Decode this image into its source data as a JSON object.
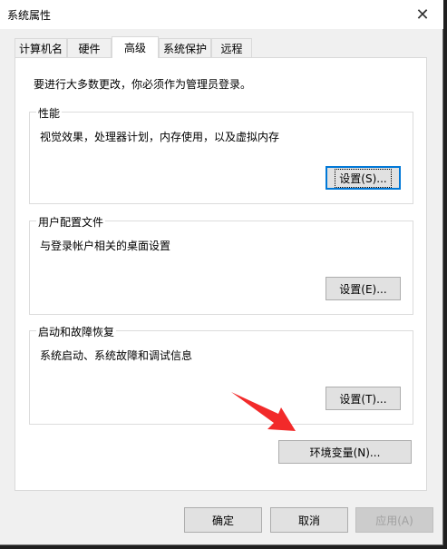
{
  "window": {
    "title": "系统属性",
    "close_glyph": "✕"
  },
  "tabs": [
    {
      "label": "计算机名",
      "active": false
    },
    {
      "label": "硬件",
      "active": false
    },
    {
      "label": "高级",
      "active": true
    },
    {
      "label": "系统保护",
      "active": false
    },
    {
      "label": "远程",
      "active": false
    }
  ],
  "advanced": {
    "note": "要进行大多数更改，你必须作为管理员登录。",
    "performance": {
      "legend": "性能",
      "desc": "视觉效果，处理器计划，内存使用，以及虚拟内存",
      "button": "设置(S)..."
    },
    "user_profiles": {
      "legend": "用户配置文件",
      "desc": "与登录帐户相关的桌面设置",
      "button": "设置(E)..."
    },
    "startup_recovery": {
      "legend": "启动和故障恢复",
      "desc": "系统启动、系统故障和调试信息",
      "button": "设置(T)..."
    },
    "env_button": "环境变量(N)..."
  },
  "footer": {
    "ok": "确定",
    "cancel": "取消",
    "apply": "应用(A)"
  },
  "colors": {
    "accent": "#0078d7",
    "arrow": "#f22a2a"
  },
  "icons": {
    "close": "close-icon",
    "arrow": "red-arrow-annotation"
  }
}
